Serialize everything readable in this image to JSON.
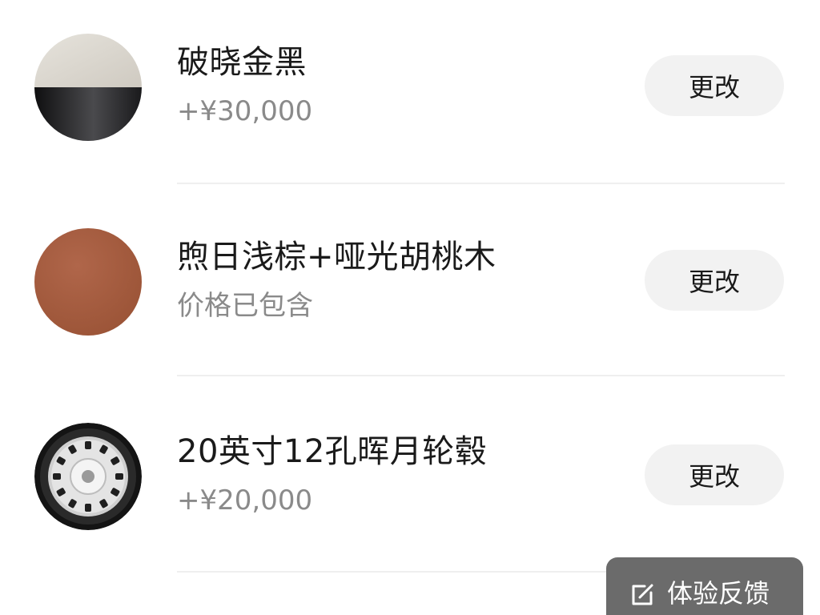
{
  "options": [
    {
      "title": "破晓金黑",
      "subtitle": "+¥30,000",
      "button": "更改",
      "swatch": {
        "type": "two-tone",
        "top_color": "#d8d4cc",
        "bottom_color": "#1c1c1e"
      }
    },
    {
      "title": "煦日浅棕+哑光胡桃木",
      "subtitle": "价格已包含",
      "button": "更改",
      "swatch": {
        "type": "solid",
        "color": "#a2593c"
      }
    },
    {
      "title": "20英寸12孔晖月轮毂",
      "subtitle": "+¥20,000",
      "button": "更改",
      "swatch": {
        "type": "wheel-icon",
        "tire_color": "#1a1a1a",
        "rim_color": "#d9d9d9"
      }
    }
  ],
  "feedback": {
    "label": "体验反馈",
    "icon": "edit-note-icon",
    "background": "#6b6b6b"
  },
  "colors": {
    "button_bg": "#f2f2f2",
    "subtitle_text": "#8a8a8a",
    "divider": "#efefef"
  }
}
